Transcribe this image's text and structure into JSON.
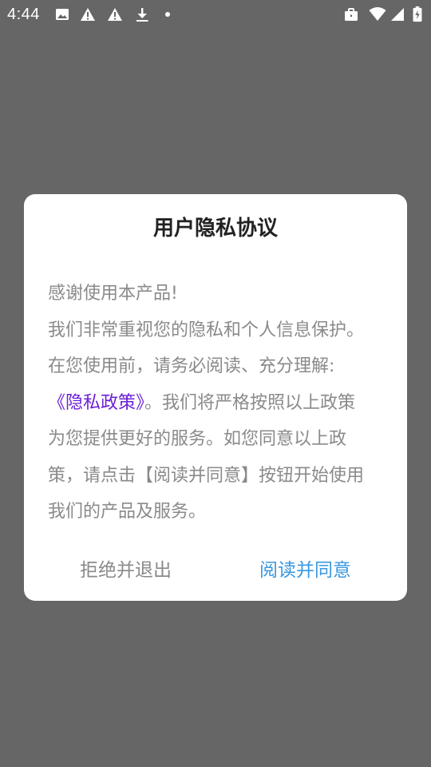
{
  "status_bar": {
    "time": "4:44",
    "left_icons": [
      "image-icon",
      "warning-icon",
      "warning-icon",
      "download-icon",
      "dot-icon"
    ],
    "right_icons": [
      "briefcase-icon",
      "wifi-icon",
      "signal-icon",
      "battery-charging-icon"
    ]
  },
  "dialog": {
    "title": "用户隐私协议",
    "body_lines": {
      "l1": "感谢使用本产品!",
      "l2": "我们非常重视您的隐私和个人信息保护。",
      "l3": "在您使用前，请务必阅读、充分理解:",
      "l4_link": "《隐私政策》",
      "l4_rest": "。我们将严格按照以上政策",
      "l5": "为您提供更好的服务。如您同意以上政",
      "l6": "策，请点击【阅读并同意】按钮开始使用",
      "l7": "我们的产品及服务。"
    },
    "buttons": {
      "reject": "拒绝并退出",
      "agree": "阅读并同意"
    },
    "colors": {
      "link": "#6b1fd6",
      "agree": "#3a98e0",
      "reject": "#8a8a8a",
      "overlay": "#666666"
    }
  }
}
